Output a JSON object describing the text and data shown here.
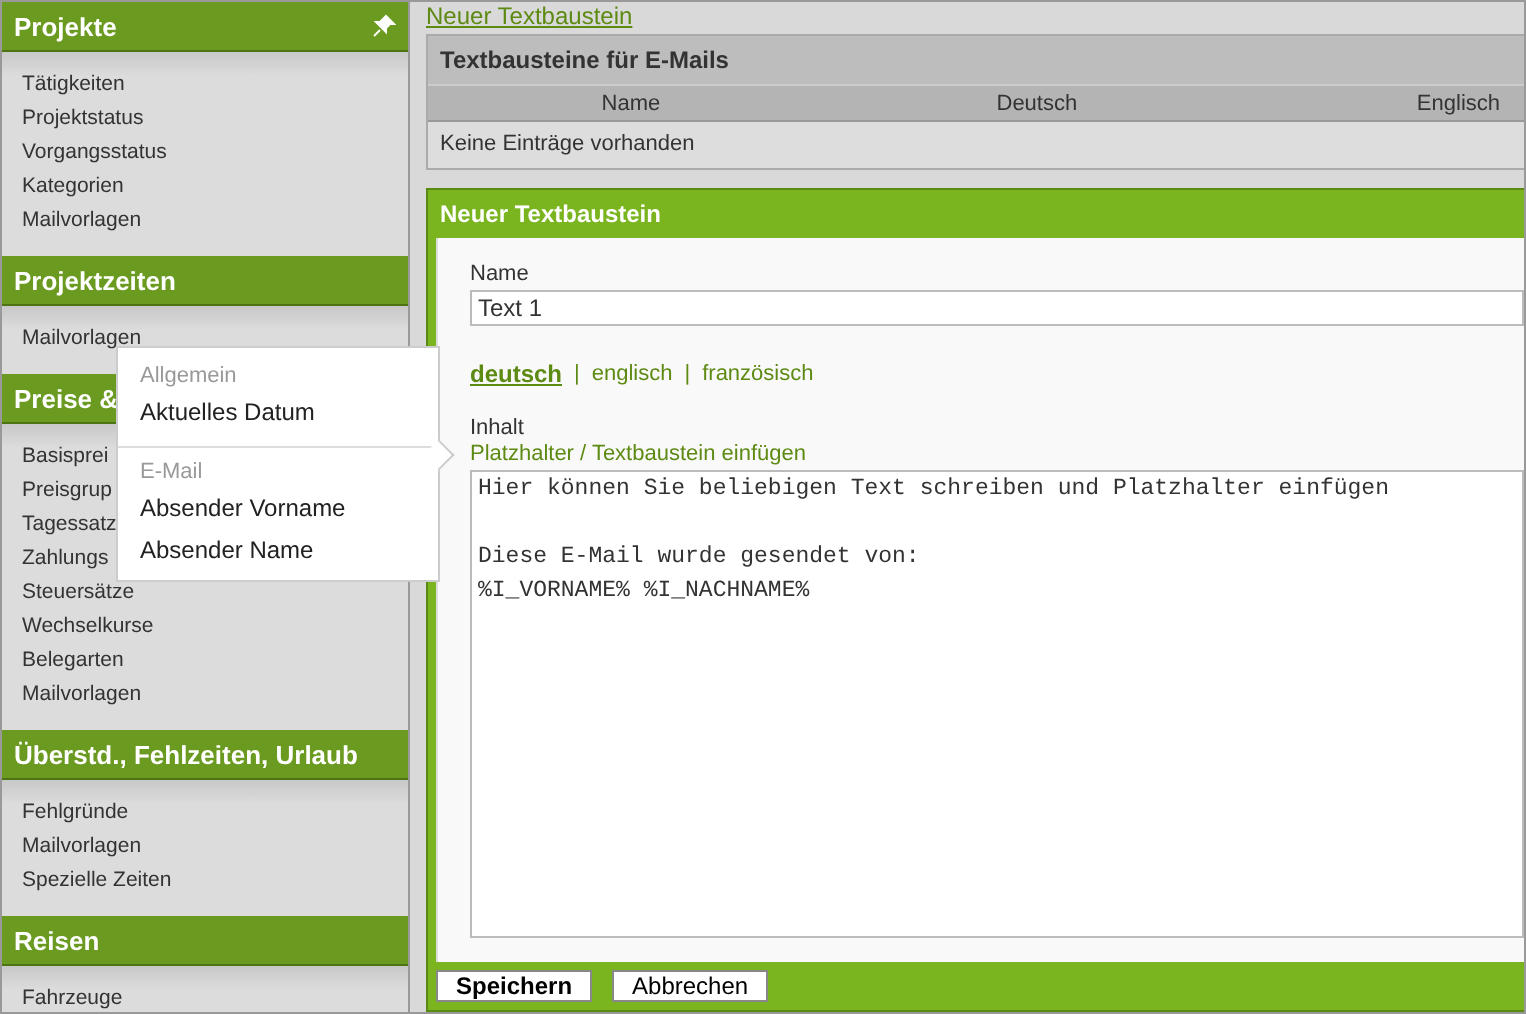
{
  "sidebar": {
    "sections": [
      {
        "title": "Projekte",
        "pin": true,
        "items": [
          "Tätigkeiten",
          "Projektstatus",
          "Vorgangsstatus",
          "Kategorien",
          "Mailvorlagen"
        ]
      },
      {
        "title": "Projektzeiten",
        "items": [
          "Mailvorlagen"
        ]
      },
      {
        "title": "Preise &",
        "items": [
          "Basisprei",
          "Preisgrup",
          "Tagessatz",
          "Zahlungs",
          "Steuersätze",
          "Wechselkurse",
          "Belegarten",
          "Mailvorlagen"
        ]
      },
      {
        "title": "Überstd., Fehlzeiten, Urlaub",
        "items": [
          "Fehlgründe",
          "Mailvorlagen",
          "Spezielle Zeiten"
        ]
      },
      {
        "title": "Reisen",
        "items": [
          "Fahrzeuge"
        ]
      }
    ]
  },
  "popup": {
    "groups": [
      {
        "heading": "Allgemein",
        "items": [
          "Aktuelles Datum"
        ]
      },
      {
        "heading": "E-Mail",
        "items": [
          "Absender Vorname",
          "Absender Name"
        ]
      }
    ]
  },
  "top_link": "Neuer Textbaustein",
  "table": {
    "title": "Textbausteine für E-Mails",
    "columns": [
      "Name",
      "Deutsch",
      "Englisch"
    ],
    "empty_text": "Keine Einträge vorhanden"
  },
  "form": {
    "title": "Neuer Textbaustein",
    "name_label": "Name",
    "name_value": "Text 1",
    "languages": [
      {
        "label": "deutsch",
        "selected": true
      },
      {
        "label": "englisch",
        "selected": false
      },
      {
        "label": "französisch",
        "selected": false
      }
    ],
    "separator": "|",
    "content_label": "Inhalt",
    "insert_link": "Platzhalter / Textbaustein einfügen",
    "content_value": "Hier können Sie beliebigen Text schreiben und Platzhalter einfügen\n\nDiese E-Mail wurde gesendet von:\n%I_VORNAME% %I_NACHNAME%",
    "buttons": [
      {
        "label": "Speichern",
        "primary": true
      },
      {
        "label": "Abbrechen",
        "primary": false
      }
    ]
  }
}
